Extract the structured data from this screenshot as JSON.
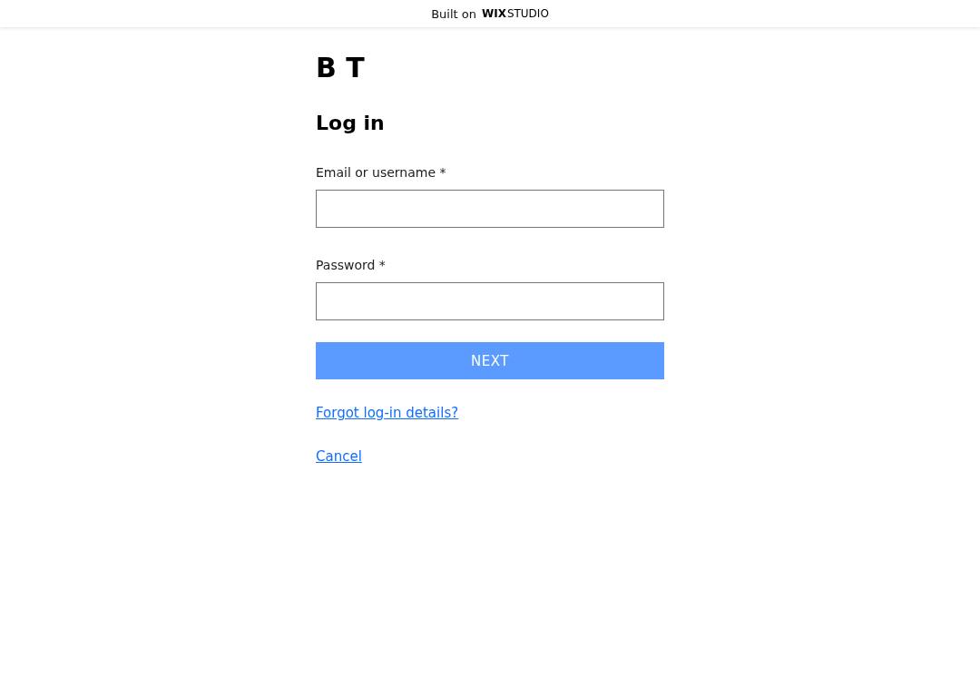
{
  "banner": {
    "prefix": "Built on",
    "brand_bold": "WIX",
    "brand_light": "STUDIO"
  },
  "logo": "B T",
  "title": "Log in",
  "fields": [
    {
      "label": "Email or username *"
    },
    {
      "label": "Password *"
    }
  ],
  "submit": {
    "label": "NEXT",
    "disabled": true
  },
  "links": [
    "Forgot log-in details?",
    "Cancel"
  ]
}
